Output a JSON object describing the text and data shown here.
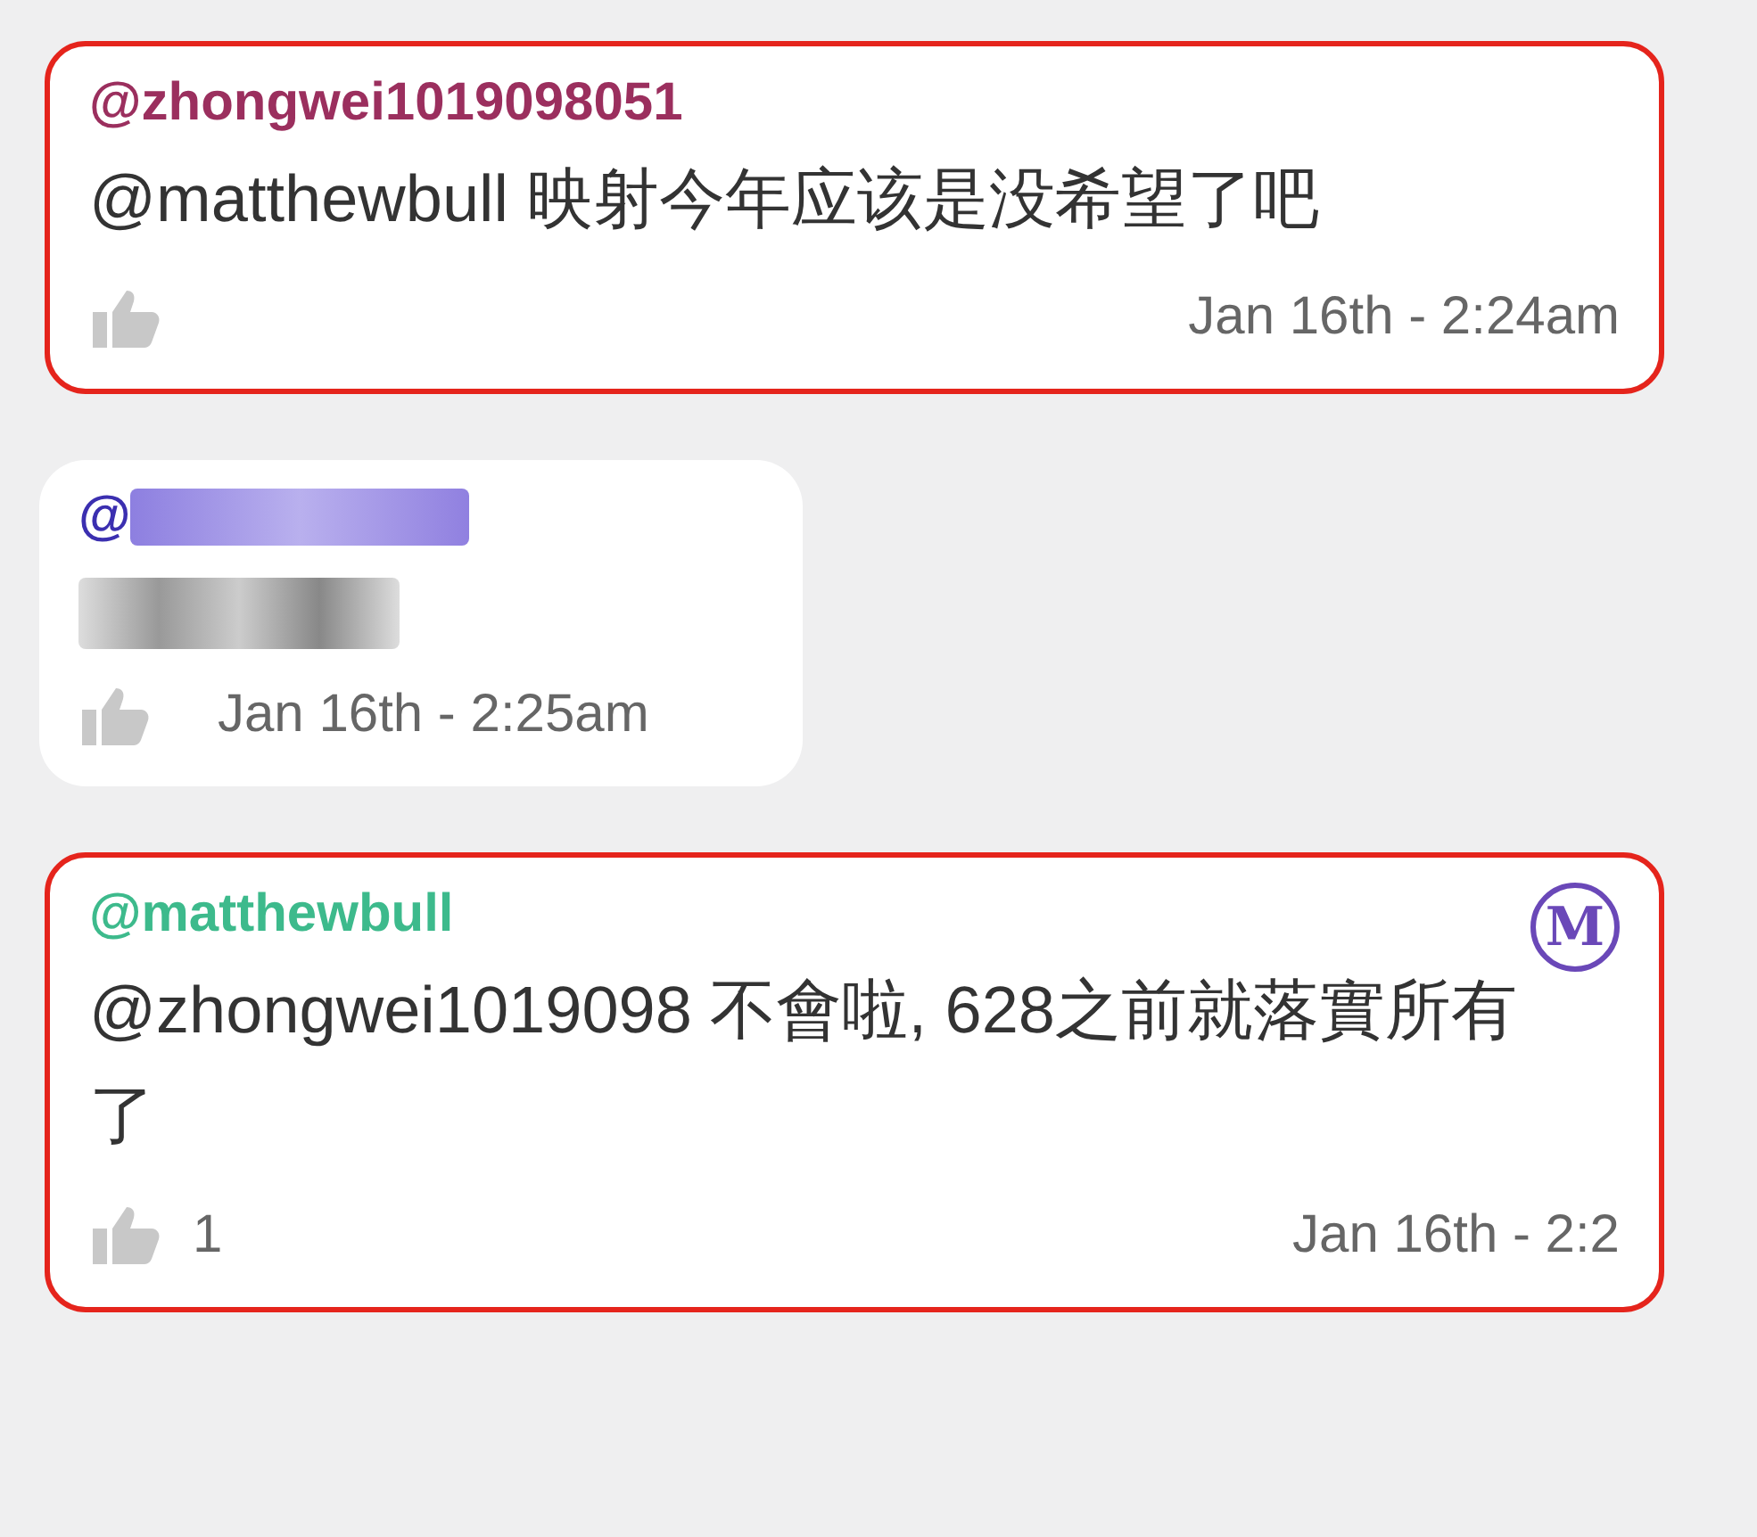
{
  "comments": [
    {
      "author": "@zhongwei1019098051",
      "color": "#9b2f5e",
      "highlighted": true,
      "mention": "@matthewbull",
      "text": "映射今年应该是没希望了吧",
      "time": "Jan 16th - 2:24am"
    },
    {
      "author": "@",
      "color": "#3b2fb0",
      "highlighted": false,
      "redacted": true,
      "time": "Jan 16th - 2:25am"
    },
    {
      "author": "@matthewbull",
      "color": "#3dba8c",
      "highlighted": true,
      "mention": "@zhongwei1019098",
      "text": "不會啦, 628之前就落實所有了",
      "likes": "1",
      "time": "Jan 16th - 2:2",
      "badge": "M"
    }
  ]
}
